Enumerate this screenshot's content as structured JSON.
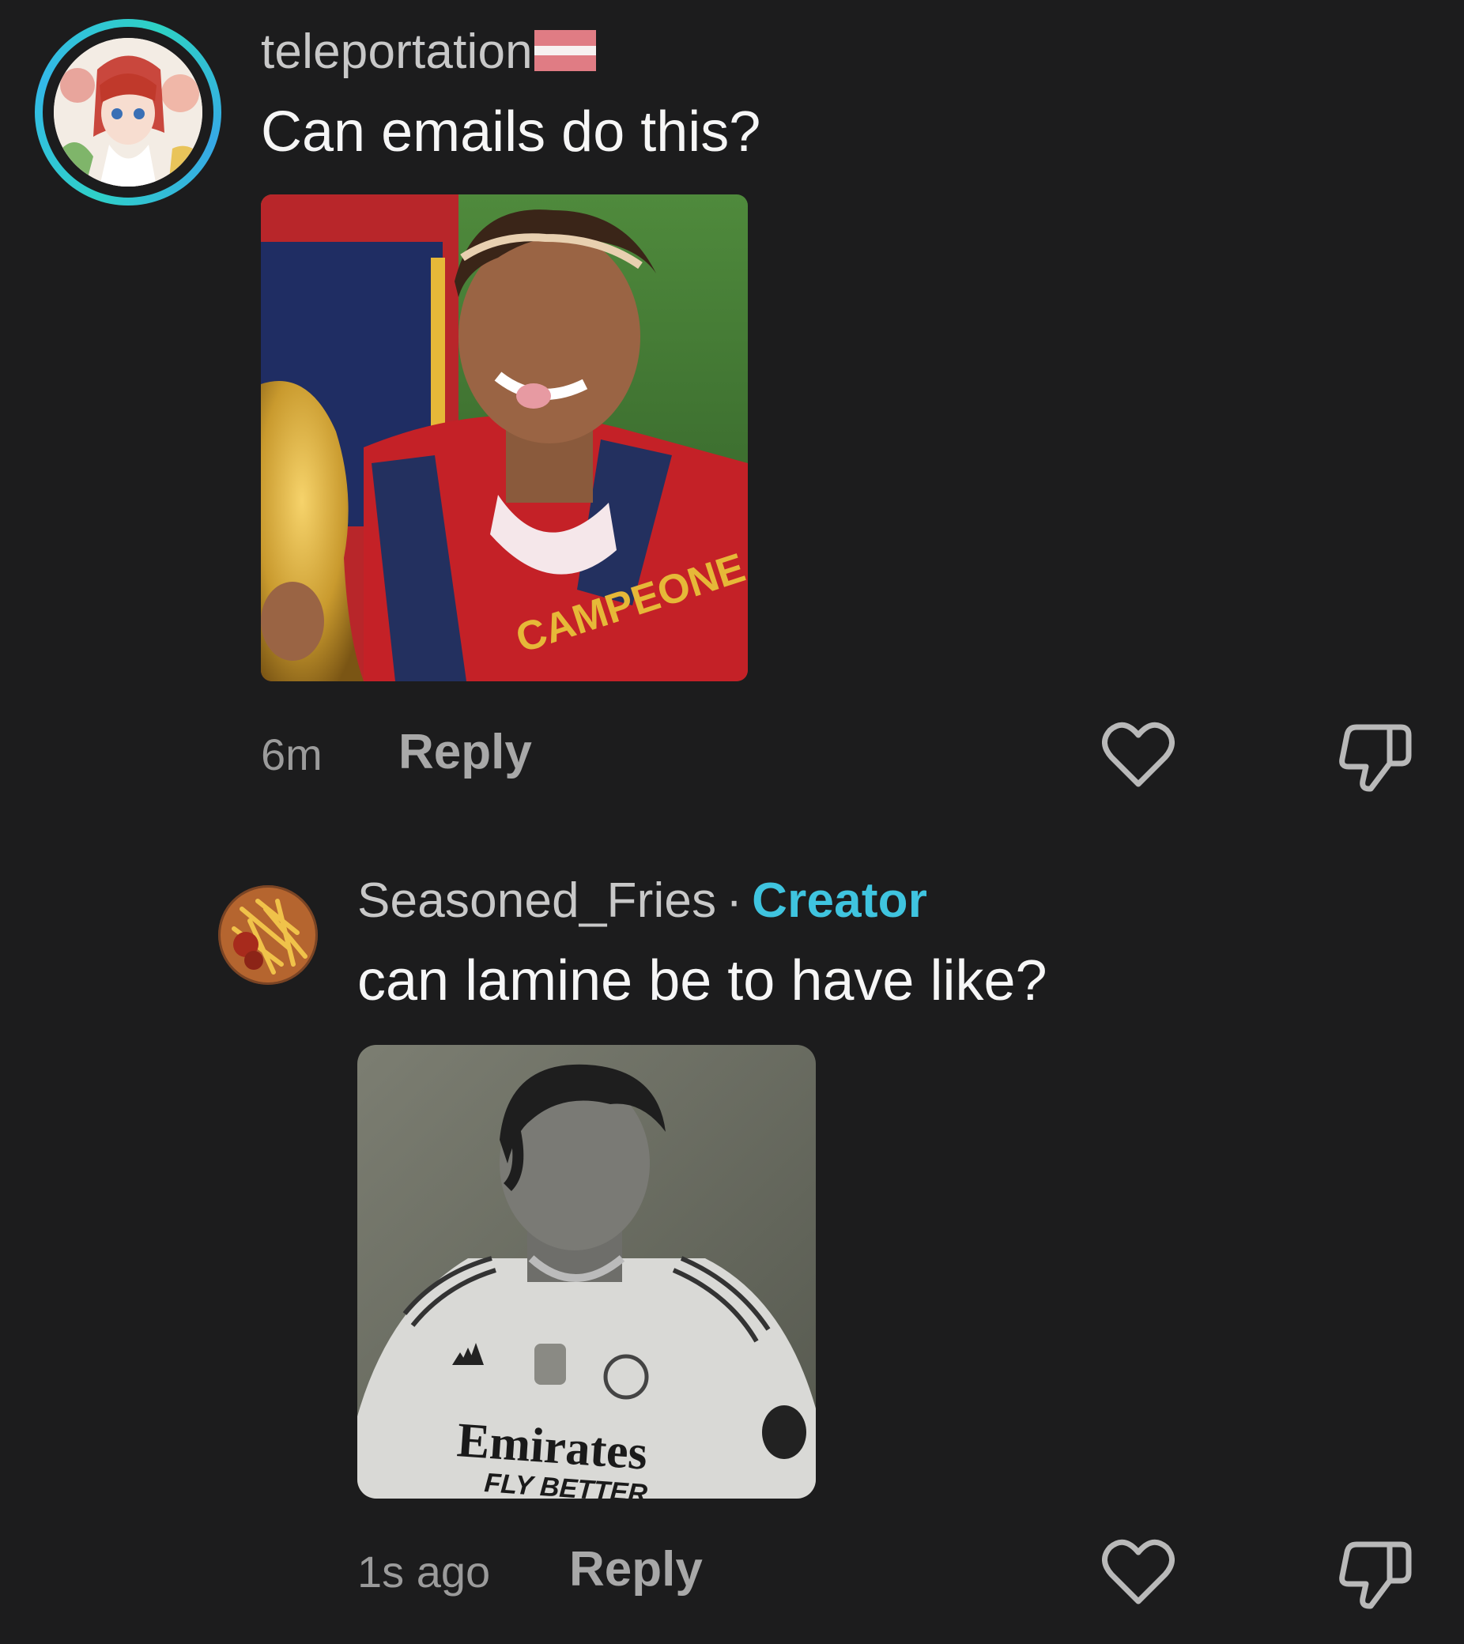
{
  "comments": [
    {
      "username": "teleportation",
      "flag": "latvia-flag",
      "text": "Can emails do this?",
      "image_alt": "Young footballer in red Spain jersey kissing the World Cup trophy",
      "image_caption_text": "CAMPEONE",
      "time": "6m",
      "reply_label": "Reply"
    },
    {
      "username": "Seasoned_Fries",
      "separator": "·",
      "badge": "Creator",
      "text": "can lamine be to have like?",
      "image_alt": "Black and white photo of footballer in white Real Madrid jersey",
      "image_caption_text": "Emirates",
      "image_caption_sub": "FLY BETTER",
      "time": "1s ago",
      "reply_label": "Reply"
    }
  ],
  "icons": {
    "like": "heart-outline-icon",
    "dislike": "thumbs-down-outline-icon"
  },
  "colors": {
    "background": "#1c1c1d",
    "creator_accent": "#3fc4df",
    "avatar_ring": "#2fd0c9"
  }
}
